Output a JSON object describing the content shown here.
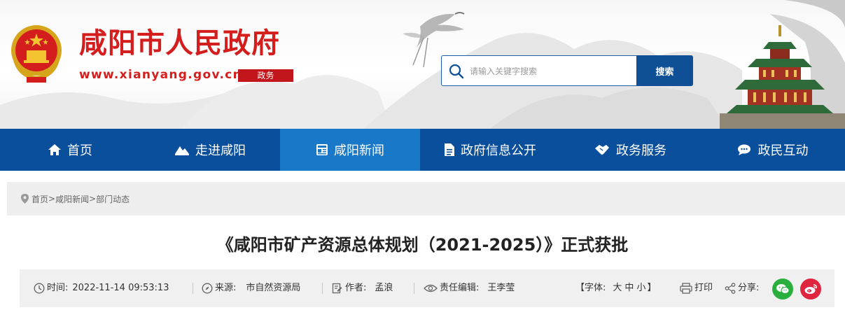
{
  "header": {
    "site_title": "咸阳市人民政府",
    "site_url": "www.xianyang.gov.cn",
    "site_badge": "政务",
    "search_placeholder": "请输入关键字搜索",
    "search_button": "搜索"
  },
  "nav": {
    "items": [
      {
        "label": "首页",
        "icon": "home-icon"
      },
      {
        "label": "走进咸阳",
        "icon": "mountain-icon"
      },
      {
        "label": "咸阳新闻",
        "icon": "newspaper-icon",
        "active": true
      },
      {
        "label": "政府信息公开",
        "icon": "document-icon"
      },
      {
        "label": "政务服务",
        "icon": "handshake-icon"
      },
      {
        "label": "政民互动",
        "icon": "chat-icon"
      }
    ]
  },
  "breadcrumb": {
    "items": [
      "首页",
      "咸阳新闻",
      "部门动态"
    ],
    "separator": ">"
  },
  "article": {
    "title": "《咸阳市矿产资源总体规划（2021-2025）》正式获批",
    "time_label": "时间:",
    "time_value": "2022-11-14 09:53:13",
    "source_label": "来源:",
    "source_value": "市自然资源局",
    "author_label": "作者:",
    "author_value": "孟浪",
    "editor_label": "责任编辑:",
    "editor_value": "王李莹",
    "font_open": "【字体:",
    "font_large": "大",
    "font_medium": "中",
    "font_small": "小",
    "font_close": "】",
    "print_label": "打印",
    "share_label": "分享:"
  },
  "colors": {
    "brand_red": "#d41e1e",
    "nav_blue": "#0a4f9c",
    "nav_active": "#1a78c8",
    "wechat_green": "#2aae3e",
    "weibo_red": "#e0253e"
  }
}
